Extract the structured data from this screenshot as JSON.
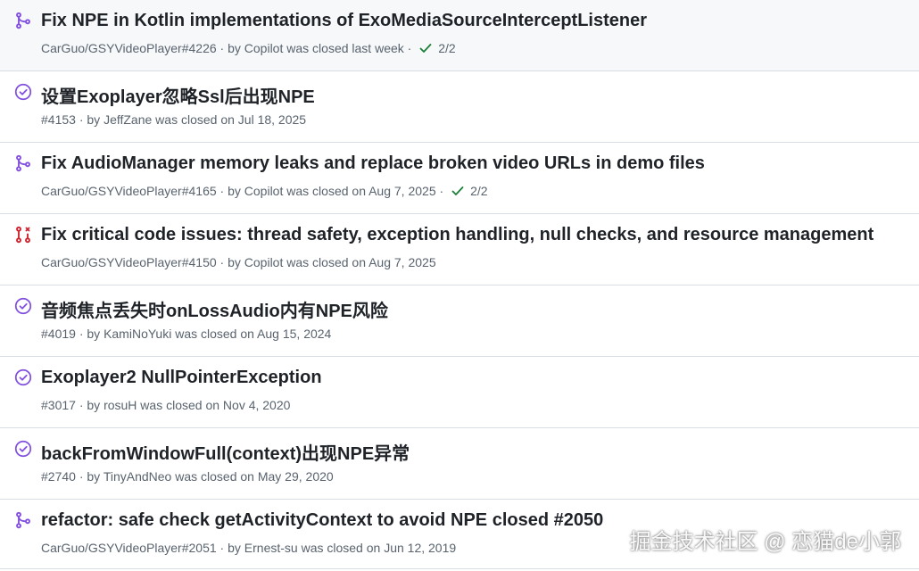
{
  "colors": {
    "merged_purple": "#8250df",
    "closed_red": "#cf222e",
    "check_green": "#1a7f37",
    "text_primary": "#1f2328",
    "text_secondary": "#59636e"
  },
  "items": [
    {
      "icon": "merged-pr-icon",
      "title": "Fix NPE in Kotlin implementations of ExoMediaSourceInterceptListener",
      "ref": "CarGuo/GSYVideoPlayer#4226",
      "by_prefix": " · by ",
      "author": "Copilot",
      "status": " was closed last week",
      "checks_sep": " · ",
      "checks": "2/2"
    },
    {
      "icon": "closed-issue-icon",
      "title": "设置Exoplayer忽略Ssl后出现NPE",
      "ref": "#4153",
      "by_prefix": " · by ",
      "author": "JeffZane",
      "status": " was closed on Jul 18, 2025"
    },
    {
      "icon": "merged-pr-icon",
      "title": "Fix AudioManager memory leaks and replace broken video URLs in demo files",
      "ref": "CarGuo/GSYVideoPlayer#4165",
      "by_prefix": " · by ",
      "author": "Copilot",
      "status": " was closed on Aug 7, 2025",
      "checks_sep": " · ",
      "checks": "2/2"
    },
    {
      "icon": "closed-pr-icon",
      "title": "Fix critical code issues: thread safety, exception handling, null checks, and resource management",
      "ref": "CarGuo/GSYVideoPlayer#4150",
      "by_prefix": " · by ",
      "author": "Copilot",
      "status": " was closed on Aug 7, 2025"
    },
    {
      "icon": "closed-issue-icon",
      "title": "音频焦点丢失时onLossAudio内有NPE风险",
      "ref": "#4019",
      "by_prefix": " · by ",
      "author": "KamiNoYuki",
      "status": " was closed on Aug 15, 2024"
    },
    {
      "icon": "closed-issue-icon",
      "title": "Exoplayer2 NullPointerException",
      "ref": "#3017",
      "by_prefix": " · by ",
      "author": "rosuH",
      "status": " was closed on Nov 4, 2020"
    },
    {
      "icon": "closed-issue-icon",
      "title": "backFromWindowFull(context)出现NPE异常",
      "ref": "#2740",
      "by_prefix": " · by ",
      "author": "TinyAndNeo",
      "status": " was closed on May 29, 2020"
    },
    {
      "icon": "merged-pr-icon",
      "title": "refactor: safe check getActivityContext to avoid NPE closed #2050",
      "ref": "CarGuo/GSYVideoPlayer#2051",
      "by_prefix": " · by ",
      "author": "Ernest-su",
      "status": " was closed on Jun 12, 2019"
    }
  ],
  "watermark": "掘金技术社区 @ 恋猫de小郭"
}
